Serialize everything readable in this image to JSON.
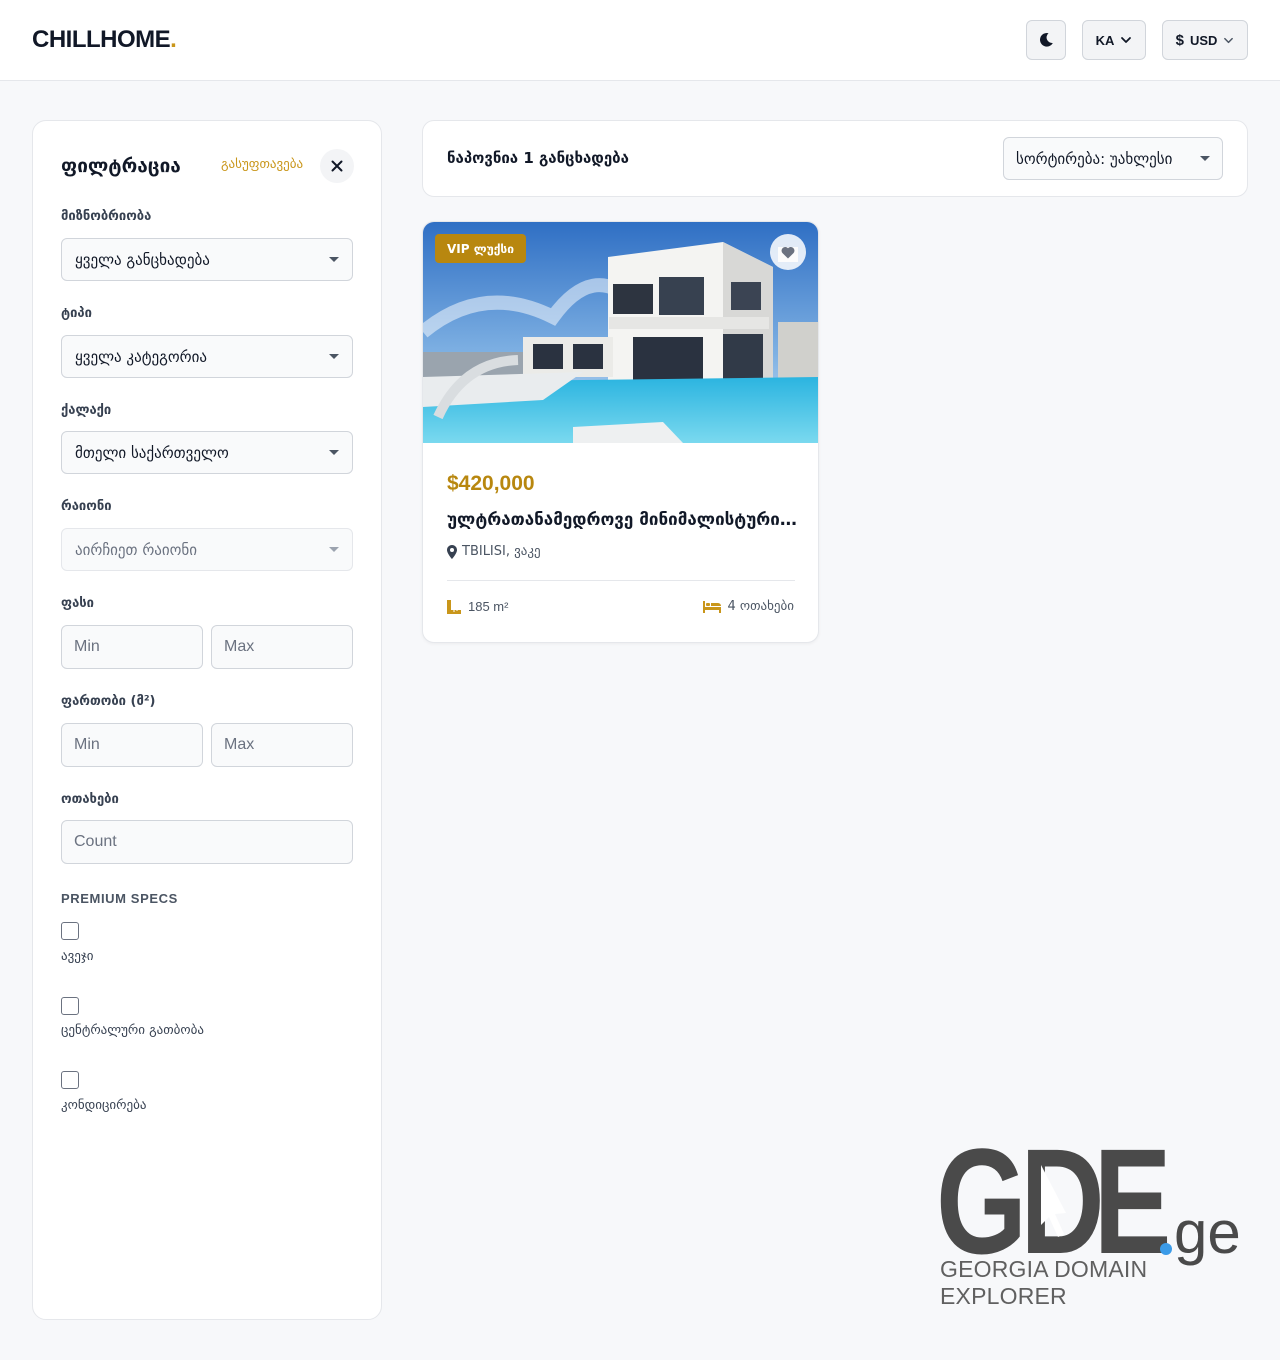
{
  "header": {
    "logo_text": "CHILLHOME",
    "logo_dot": ".",
    "language": "KA",
    "currency_symbol": "$",
    "currency": "USD"
  },
  "filters": {
    "title": "ფილტრაცია",
    "reset_label": "გასუფთავება",
    "deal_type": {
      "label": "მიზნობრიობა",
      "value": "ყველა განცხადება"
    },
    "type": {
      "label": "ტიპი",
      "value": "ყველა კატეგორია"
    },
    "city": {
      "label": "ქალაქი",
      "value": "მთელი საქართველო"
    },
    "district": {
      "label": "რაიონი",
      "value": "აირჩიეთ რაიონი"
    },
    "price": {
      "label": "ფასი",
      "min_placeholder": "Min",
      "max_placeholder": "Max"
    },
    "area": {
      "label": "ფართობი (მ²)",
      "min_placeholder": "Min",
      "max_placeholder": "Max"
    },
    "rooms": {
      "label": "ოთახები",
      "placeholder": "Count"
    },
    "premium_heading": "PREMIUM SPECS",
    "premium_specs": [
      {
        "label": "ავეჯი",
        "checked": false
      },
      {
        "label": "ცენტრალური გათბობა",
        "checked": false
      },
      {
        "label": "კონდიცირება",
        "checked": false
      }
    ]
  },
  "results": {
    "count_text": "ნაპოვნია 1 განცხადება",
    "sort_value": "სორტირება: უახლესი"
  },
  "listings": [
    {
      "badge": "VIP ლუქსი",
      "price": "$420,000",
      "title": "ულტრათანამედროვე მინიმალისტური ვილა",
      "location": "TBILISI, ვაკე",
      "area": "185 m²",
      "rooms": "4 ოთახები",
      "favorited": false
    }
  ],
  "watermark": {
    "brand_left": "G",
    "brand_mid": "D",
    "brand_right": "E",
    "brand_tld": "ge",
    "subtitle": "GEORGIA DOMAIN EXPLORER"
  },
  "colors": {
    "accent": "#c9961a",
    "accent_dark": "#b8870f",
    "watermark_gray": "#4a4a4a",
    "watermark_blue": "#3b9be8"
  }
}
